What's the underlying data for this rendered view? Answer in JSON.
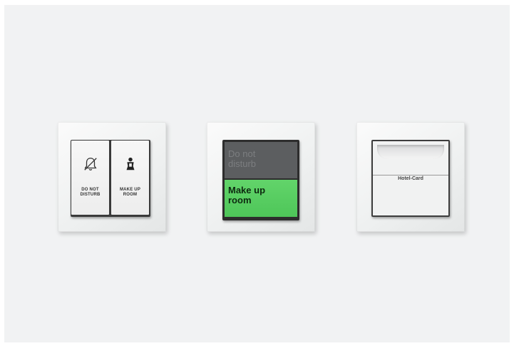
{
  "switches": {
    "dnd_mur": {
      "left_icon": "bell-crossed-icon",
      "left_label": "DO NOT\nDISTURB",
      "right_icon": "maid-icon",
      "right_label": "MAKE UP\nROOM"
    },
    "indicator": {
      "top_text": "Do not disturb",
      "bottom_text": "Make up room",
      "top_color": "#5c5e60",
      "bottom_color": "#4ec659"
    },
    "card_holder": {
      "label": "Hotel-Card"
    }
  }
}
